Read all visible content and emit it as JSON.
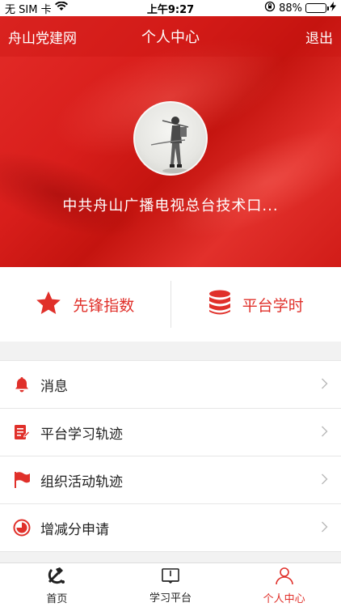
{
  "status_bar": {
    "carrier": "无 SIM 卡",
    "time": "上午9:27",
    "battery": "88%",
    "battery_level": 0.88
  },
  "navbar": {
    "left_label": "舟山党建网",
    "title": "个人中心",
    "right_label": "退出"
  },
  "profile": {
    "org_name": "中共舟山广播电视总台技术口..."
  },
  "stats": [
    {
      "label": "先锋指数",
      "icon": "star-icon"
    },
    {
      "label": "平台学时",
      "icon": "database-icon"
    }
  ],
  "menu": [
    {
      "label": "消息",
      "icon": "bell-icon"
    },
    {
      "label": "平台学习轨迹",
      "icon": "study-record-icon"
    },
    {
      "label": "组织活动轨迹",
      "icon": "flag-icon"
    },
    {
      "label": "增减分申请",
      "icon": "clock-chart-icon"
    }
  ],
  "tabbar": [
    {
      "label": "首页",
      "icon": "party-emblem-icon",
      "active": false
    },
    {
      "label": "学习平台",
      "icon": "book-icon",
      "active": false
    },
    {
      "label": "个人中心",
      "icon": "person-icon",
      "active": true
    }
  ],
  "colors": {
    "accent": "#e0302a",
    "hero": "#d81e1b"
  }
}
